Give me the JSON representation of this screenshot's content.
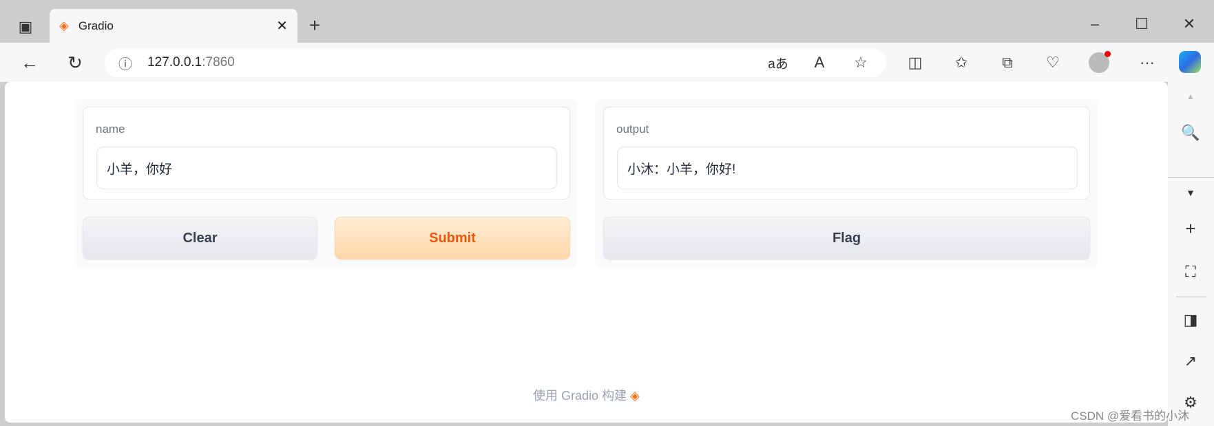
{
  "browser": {
    "tab_title": "Gradio",
    "url_host": "127.0.0.1",
    "url_port": ":7860",
    "icons": [
      "tab-actions-icon",
      "gradio-logo-icon",
      "close-icon",
      "new-tab-icon",
      "minimize-icon",
      "maximize-icon",
      "window-close-icon",
      "back-icon",
      "refresh-icon",
      "info-icon",
      "translate-icon",
      "read-aloud-icon",
      "favorite-icon",
      "split-screen-icon",
      "favorites-icon",
      "collections-icon",
      "browser-essentials-icon",
      "profile-icon",
      "more-icon",
      "copilot-icon"
    ]
  },
  "app": {
    "input_label": "name",
    "input_value": "小羊，你好",
    "output_label": "output",
    "output_value": "小沐：小羊，你好!",
    "clear_label": "Clear",
    "submit_label": "Submit",
    "flag_label": "Flag",
    "footer": "使用 Gradio 构建",
    "accent": "#ea580c"
  },
  "watermark": "CSDN @爱看书的小沐"
}
